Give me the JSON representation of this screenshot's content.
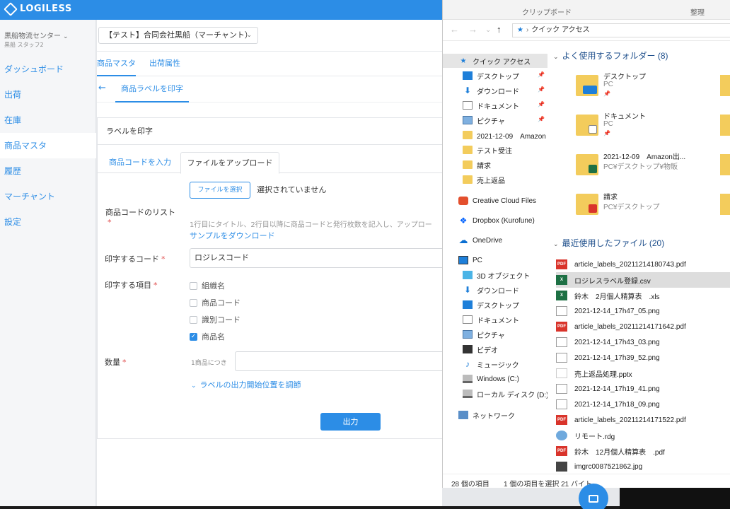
{
  "app": {
    "logo_text": "LOGILESS",
    "center_name": "黒船物流センター",
    "staff_name": "黒船 スタッフ2",
    "merchant": "【テスト】合同会社黒船（マーチャント）",
    "menu": [
      {
        "label": "ダッシュボード"
      },
      {
        "label": "出荷"
      },
      {
        "label": "在庫"
      },
      {
        "label": "商品マスタ"
      },
      {
        "label": "履歴"
      },
      {
        "label": "マーチャント"
      },
      {
        "label": "設定"
      }
    ],
    "subtabs": [
      "商品マスタ",
      "出荷属性"
    ],
    "breadcrumb": "商品ラベルを印字",
    "panel_title": "ラベルを印字",
    "form_tabs": [
      "商品コードを入力",
      "ファイルをアップロード"
    ],
    "code_list_label": "商品コードのリスト",
    "file_button": "ファイルを選択",
    "file_status": "選択されていません",
    "help_text": "1行目にタイトル、2行目以降に商品コードと発行枚数を記入し、アップロー",
    "sample_link": "サンプルをダウンロード",
    "code_label": "印字するコード",
    "code_value": "ロジレスコード",
    "items_label": "印字する項目",
    "checkboxes": [
      {
        "label": "組織名",
        "checked": false
      },
      {
        "label": "商品コード",
        "checked": false
      },
      {
        "label": "識別コード",
        "checked": false
      },
      {
        "label": "商品名",
        "checked": true
      }
    ],
    "qty_label": "数量",
    "qty_per": "1商品につき",
    "adjust_link": "ラベルの出力開始位置を調節",
    "print_button": "出力",
    "required_mark": "*"
  },
  "explorer": {
    "ribbon": [
      "クリップボード",
      "整理"
    ],
    "address": "クイック アクセス",
    "nav": [
      {
        "label": "クイック アクセス",
        "icon": "star-icon",
        "sel": true
      },
      {
        "label": "デスクトップ",
        "icon": "desktop-icon",
        "pin": true
      },
      {
        "label": "ダウンロード",
        "icon": "download-icon",
        "pin": true
      },
      {
        "label": "ドキュメント",
        "icon": "document-icon",
        "pin": true
      },
      {
        "label": "ピクチャ",
        "icon": "picture-icon",
        "pin": true
      },
      {
        "label": "2021-12-09　Amazon",
        "icon": "folder-icon"
      },
      {
        "label": "テスト受注",
        "icon": "folder-icon"
      },
      {
        "label": "請求",
        "icon": "folder-icon"
      },
      {
        "label": "売上返品",
        "icon": "folder-icon"
      },
      {
        "label": "Creative Cloud Files",
        "icon": "creative-cloud-icon"
      },
      {
        "label": "Dropbox (Kurofune)",
        "icon": "dropbox-icon"
      },
      {
        "label": "OneDrive",
        "icon": "onedrive-icon"
      },
      {
        "label": "PC",
        "icon": "pc-icon"
      },
      {
        "label": "3D オブジェクト",
        "icon": "3d-objects-icon"
      },
      {
        "label": "ダウンロード",
        "icon": "download-icon"
      },
      {
        "label": "デスクトップ",
        "icon": "desktop-icon"
      },
      {
        "label": "ドキュメント",
        "icon": "document-icon"
      },
      {
        "label": "ピクチャ",
        "icon": "picture-icon"
      },
      {
        "label": "ビデオ",
        "icon": "video-icon"
      },
      {
        "label": "ミュージック",
        "icon": "music-icon"
      },
      {
        "label": "Windows (C:)",
        "icon": "drive-icon"
      },
      {
        "label": "ローカル ディスク (D:)",
        "icon": "drive-icon"
      },
      {
        "label": "ネットワーク",
        "icon": "network-icon"
      }
    ],
    "frequent_header": "よく使用するフォルダー (8)",
    "frequent": [
      {
        "name": "デスクトップ",
        "sub": "PC",
        "pin": true
      },
      {
        "name": "ドキュメント",
        "sub": "PC",
        "pin": true
      },
      {
        "name": "2021-12-09　Amazon出...",
        "sub": "PC¥デスクトップ¥物販",
        "pin": false
      },
      {
        "name": "請求",
        "sub": "PC¥デスクトップ",
        "pin": false
      }
    ],
    "recent_header": "最近使用したファイル (20)",
    "recent": [
      {
        "name": "article_labels_20211214180743.pdf",
        "type": "pdf"
      },
      {
        "name": "ロジレスラベル登録.csv",
        "type": "xls",
        "sel": true
      },
      {
        "name": "鈴木　2月個人精算表　.xls",
        "type": "xls"
      },
      {
        "name": "2021-12-14_17h47_05.png",
        "type": "png"
      },
      {
        "name": "article_labels_20211214171642.pdf",
        "type": "pdf"
      },
      {
        "name": "2021-12-14_17h43_03.png",
        "type": "png"
      },
      {
        "name": "2021-12-14_17h39_52.png",
        "type": "png"
      },
      {
        "name": "売上返品処理.pptx",
        "type": "ppt"
      },
      {
        "name": "2021-12-14_17h19_41.png",
        "type": "png"
      },
      {
        "name": "2021-12-14_17h18_09.png",
        "type": "png"
      },
      {
        "name": "article_labels_20211214171522.pdf",
        "type": "pdf"
      },
      {
        "name": "リモート.rdg",
        "type": "rdg"
      },
      {
        "name": "鈴木　12月個人精算表　.pdf",
        "type": "pdf"
      },
      {
        "name": "imgrc0087521862.jpg",
        "type": "jpg"
      }
    ],
    "status_items": "28 個の項目",
    "status_selected": "1 個の項目を選択  21 バイト",
    "pdf_badge": "PDF",
    "xls_badge": "X"
  },
  "colors": {
    "accent": "#2c8de6",
    "explorer_link": "#1e4f8c"
  }
}
